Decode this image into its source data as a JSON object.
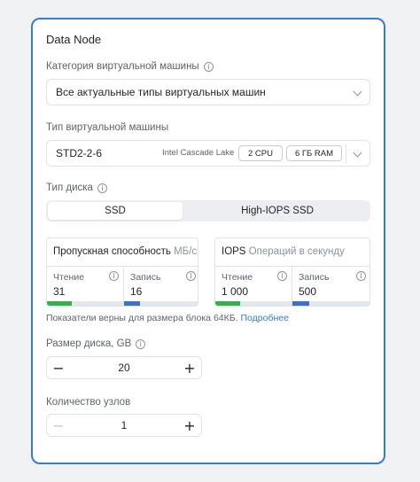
{
  "title": "Data Node",
  "vm_category": {
    "label": "Категория виртуальной машины",
    "value": "Все актуальные типы виртуальных машин"
  },
  "vm_type": {
    "label": "Тип виртуальной машины",
    "value": "STD2-2-6",
    "cpu_arch": "Intel Cascade Lake",
    "cpu": "2 CPU",
    "ram": "6 ГБ RAM"
  },
  "disk_type": {
    "label": "Тип диска",
    "tabs": [
      "SSD",
      "High-IOPS SSD"
    ],
    "selected": "SSD"
  },
  "throughput": {
    "title": "Пропускная способность",
    "unit": "МБ/с",
    "read_label": "Чтение",
    "read_value": "31",
    "write_label": "Запись",
    "write_value": "16",
    "read_level": 0.32,
    "write_level": 0.22
  },
  "iops": {
    "title": "IOPS",
    "unit": "Операций в секунду",
    "read_label": "Чтение",
    "read_value": "1 000",
    "write_label": "Запись",
    "write_value": "500",
    "read_level": 0.32,
    "write_level": 0.22
  },
  "note": {
    "text": "Показатели верны для размера блока 64КБ.",
    "link": "Подробнее"
  },
  "disk_size": {
    "label": "Размер диска, GB",
    "value": "20",
    "minus": "−",
    "plus": "+"
  },
  "node_count": {
    "label": "Количество узлов",
    "value": "1",
    "minus": "−",
    "plus": "+"
  },
  "icons": {
    "info": "ⓘ",
    "info_icon": "info-icon",
    "chevron": "chevron-down-icon"
  },
  "colors": {
    "accent": "#2f7be8",
    "read_bar": "#2fb344",
    "write_bar": "#3b6fd8"
  }
}
